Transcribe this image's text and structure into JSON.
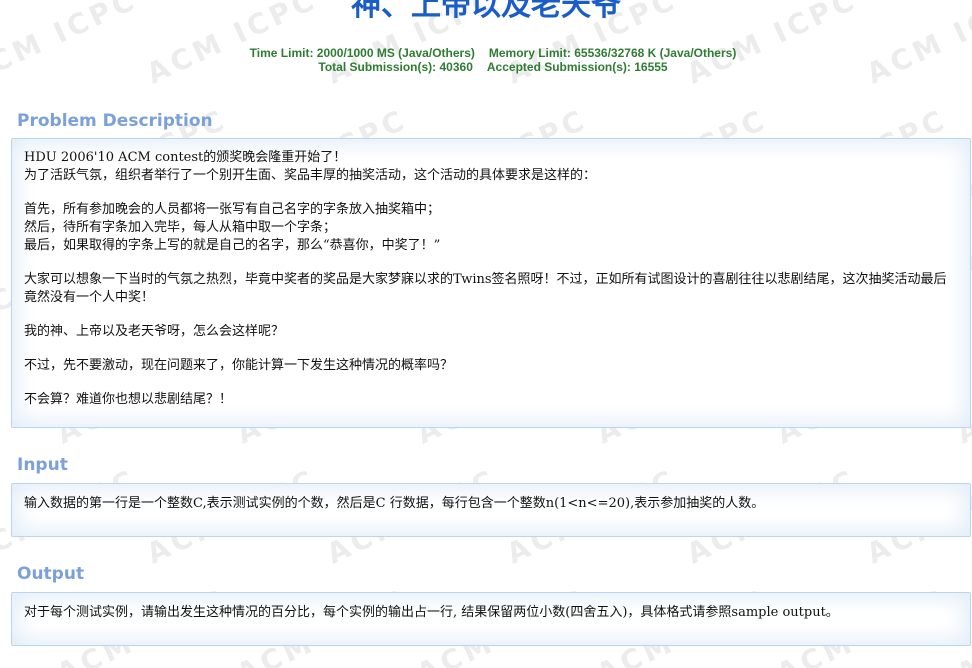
{
  "problem": {
    "title": "神、上帝以及老天爷",
    "time_limit": "Time Limit: 2000/1000 MS (Java/Others)",
    "memory_limit": "Memory Limit: 65536/32768 K (Java/Others)",
    "total_submissions": "Total Submission(s): 40360",
    "accepted_submissions": "Accepted Submission(s): 16555"
  },
  "watermark_text": "ACM ICPC",
  "sections": {
    "description": {
      "heading": "Problem Description",
      "p1_l1": "HDU 2006'10 ACM contest的颁奖晚会隆重开始了！",
      "p1_l2": "为了活跃气氛，组织者举行了一个别开生面、奖品丰厚的抽奖活动，这个活动的具体要求是这样的：",
      "p2_l1": "首先，所有参加晚会的人员都将一张写有自己名字的字条放入抽奖箱中；",
      "p2_l2": "然后，待所有字条加入完毕，每人从箱中取一个字条；",
      "p2_l3": "最后，如果取得的字条上写的就是自己的名字，那么“恭喜你，中奖了！”",
      "p3": "大家可以想象一下当时的气氛之热烈，毕竟中奖者的奖品是大家梦寐以求的Twins签名照呀！不过，正如所有试图设计的喜剧往往以悲剧结尾，这次抽奖活动最后竟然没有一个人中奖！",
      "p4": "我的神、上帝以及老天爷呀，怎么会这样呢？",
      "p5": "不过，先不要激动，现在问题来了，你能计算一下发生这种情况的概率吗？",
      "p6": "不会算？难道你也想以悲剧结尾？！"
    },
    "input": {
      "heading": "Input",
      "text": "输入数据的第一行是一个整数C,表示测试实例的个数，然后是C 行数据，每行包含一个整数n(1<n<=20),表示参加抽奖的人数。"
    },
    "output": {
      "heading": "Output",
      "text": "对于每个测试实例，请输出发生这种情况的百分比，每个实例的输出占一行, 结果保留两位小数(四舍五入)，具体格式请参照sample output。"
    }
  }
}
